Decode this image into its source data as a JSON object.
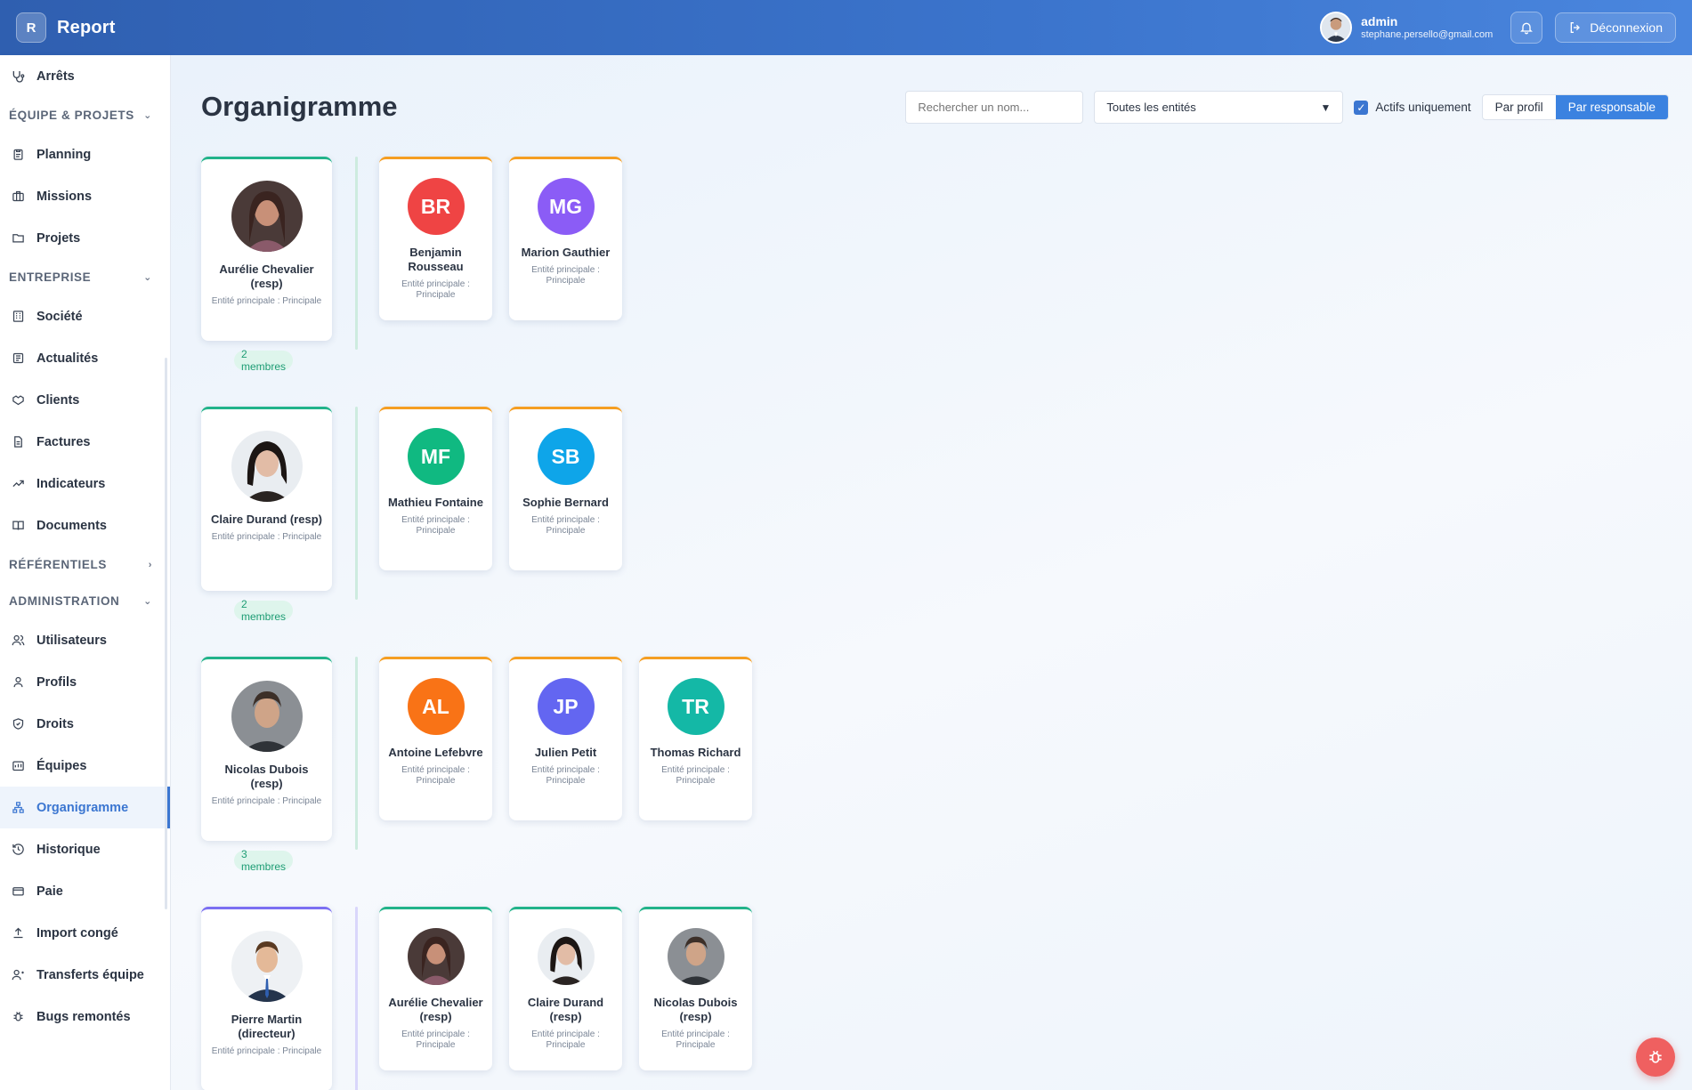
{
  "header": {
    "brand_letter": "R",
    "brand_name": "Report",
    "user_name": "admin",
    "user_email": "stephane.persello@gmail.com",
    "logout_label": "Déconnexion"
  },
  "sidebar": {
    "top_item": "Arrêts",
    "section_equipe": "ÉQUIPE & PROJETS",
    "equipe_items": [
      "Planning",
      "Missions",
      "Projets"
    ],
    "section_entreprise": "ENTREPRISE",
    "entreprise_items": [
      "Société",
      "Actualités",
      "Clients",
      "Factures",
      "Indicateurs",
      "Documents"
    ],
    "section_referentiels": "RÉFÉRENTIELS",
    "section_admin": "ADMINISTRATION",
    "admin_items": [
      "Utilisateurs",
      "Profils",
      "Droits",
      "Équipes",
      "Organigramme",
      "Historique",
      "Paie",
      "Import congé",
      "Transferts équipe",
      "Bugs remontés"
    ],
    "active": "Organigramme"
  },
  "main": {
    "title": "Organigramme",
    "search_placeholder": "Rechercher un nom...",
    "entity_select": "Toutes les entités",
    "actifs_label": "Actifs uniquement",
    "view_profil": "Par profil",
    "view_responsable": "Par responsable"
  },
  "groups": [
    {
      "resp": {
        "name": "Aurélie Chevalier (resp)",
        "sub": "Entité principale : Principale"
      },
      "badge": "2 membres",
      "members": [
        {
          "initials": "BR",
          "name": "Benjamin Rousseau",
          "sub": "Entité principale : Principale",
          "color": "#ef4444"
        },
        {
          "initials": "MG",
          "name": "Marion Gauthier",
          "sub": "Entité principale : Principale",
          "color": "#8b5cf6"
        }
      ]
    },
    {
      "resp": {
        "name": "Claire Durand (resp)",
        "sub": "Entité principale : Principale"
      },
      "badge": "2 membres",
      "members": [
        {
          "initials": "MF",
          "name": "Mathieu Fontaine",
          "sub": "Entité principale : Principale",
          "color": "#10b981"
        },
        {
          "initials": "SB",
          "name": "Sophie Bernard",
          "sub": "Entité principale : Principale",
          "color": "#0ea5e9"
        }
      ]
    },
    {
      "resp": {
        "name": "Nicolas Dubois (resp)",
        "sub": "Entité principale : Principale"
      },
      "badge": "3 membres",
      "members": [
        {
          "initials": "AL",
          "name": "Antoine Lefebvre",
          "sub": "Entité principale : Principale",
          "color": "#f97316"
        },
        {
          "initials": "JP",
          "name": "Julien Petit",
          "sub": "Entité principale : Principale",
          "color": "#6366f1"
        },
        {
          "initials": "TR",
          "name": "Thomas Richard",
          "sub": "Entité principale : Principale",
          "color": "#14b8a6"
        }
      ]
    },
    {
      "resp": {
        "name": "Pierre Martin (directeur)",
        "sub": "Entité principale : Principale"
      },
      "members": [
        {
          "name": "Aurélie Chevalier (resp)",
          "sub": "Entité principale : Principale"
        },
        {
          "name": "Claire Durand (resp)",
          "sub": "Entité principale : Principale"
        },
        {
          "name": "Nicolas Dubois (resp)",
          "sub": "Entité principale : Principale"
        }
      ]
    }
  ]
}
